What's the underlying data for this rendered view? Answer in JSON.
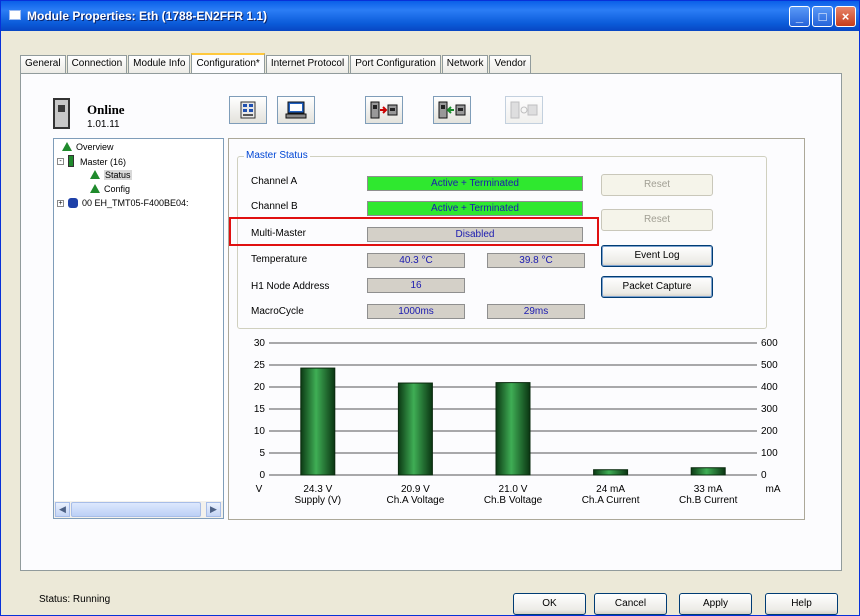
{
  "window": {
    "title": "Module Properties: Eth (1788-EN2FFR 1.1)"
  },
  "tabs": [
    {
      "label": "General"
    },
    {
      "label": "Connection"
    },
    {
      "label": "Module Info"
    },
    {
      "label": "Configuration*"
    },
    {
      "label": "Internet Protocol"
    },
    {
      "label": "Port Configuration"
    },
    {
      "label": "Network"
    },
    {
      "label": "Vendor"
    }
  ],
  "active_tab": "Configuration*",
  "status_header": {
    "state": "Online",
    "version": "1.01.11"
  },
  "tree": {
    "items": [
      {
        "label": "Overview"
      },
      {
        "label": "Master (16)"
      },
      {
        "label": "Status"
      },
      {
        "label": "Config"
      },
      {
        "label": "00 EH_TMT05-F400BE04:"
      }
    ],
    "selected": "Status"
  },
  "master_status": {
    "title": "Master Status",
    "channel_a": {
      "label": "Channel A",
      "value": "Active + Terminated"
    },
    "channel_b": {
      "label": "Channel B",
      "value": "Active + Terminated"
    },
    "multi_master": {
      "label": "Multi-Master",
      "value": "Disabled"
    },
    "temperature": {
      "label": "Temperature",
      "value1": "40.3 °C",
      "value2": "39.8 °C"
    },
    "node_address": {
      "label": "H1 Node Address",
      "value": "16"
    },
    "macrocycle": {
      "label": "MacroCycle",
      "value1": "1000ms",
      "value2": "29ms"
    },
    "buttons": {
      "reset_a": "Reset",
      "reset_b": "Reset",
      "event_log": "Event Log",
      "packet_capture": "Packet Capture"
    }
  },
  "chart_data": {
    "type": "bar",
    "categories": [
      "Supply (V)",
      "Ch.A Voltage",
      "Ch.B Voltage",
      "Ch.A Current",
      "Ch.B Current"
    ],
    "value_labels": [
      "24.3 V",
      "20.9 V",
      "21.0 V",
      "24 mA",
      "33 mA"
    ],
    "series": [
      {
        "axis": "left",
        "values": [
          24.3,
          20.9,
          21.0,
          null,
          null
        ]
      },
      {
        "axis": "right",
        "values": [
          null,
          null,
          null,
          24,
          33
        ]
      }
    ],
    "left_axis": {
      "unit": "V",
      "ylim": [
        0,
        30
      ],
      "ticks": [
        0,
        5,
        10,
        15,
        20,
        25,
        30
      ]
    },
    "right_axis": {
      "unit": "mA",
      "ylim": [
        0,
        600
      ],
      "ticks": [
        0,
        100,
        200,
        300,
        400,
        500,
        600
      ]
    },
    "grid": true,
    "bar_color": "#1f7a2e"
  },
  "status_bar": {
    "text": "Status:  Running"
  },
  "footer_buttons": {
    "ok": "OK",
    "cancel": "Cancel",
    "apply": "Apply",
    "help": "Help"
  }
}
